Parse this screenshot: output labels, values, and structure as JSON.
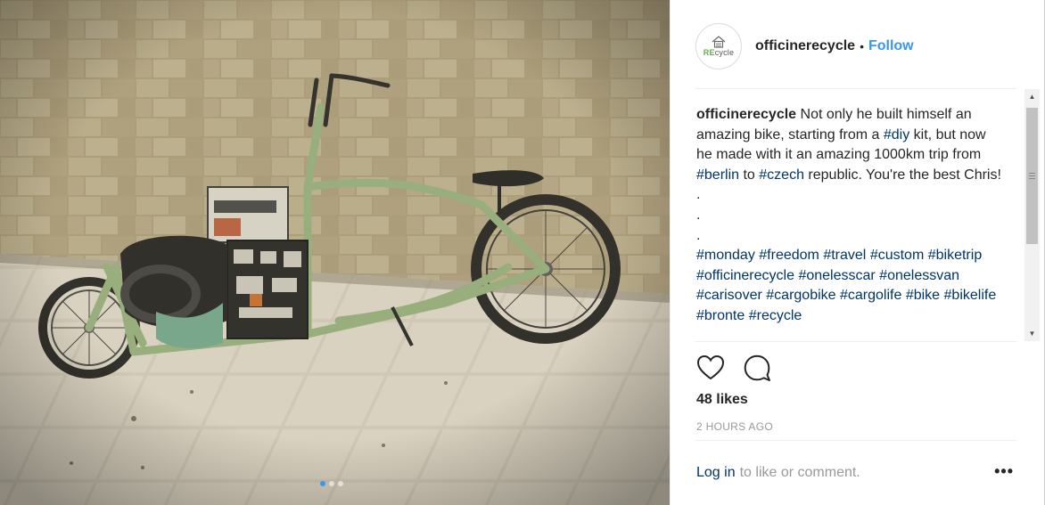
{
  "post": {
    "username": "officinerecycle",
    "separator": "•",
    "follow_label": "Follow",
    "avatar": {
      "logo_prefix": "RE",
      "logo_suffix": "cycle",
      "icon": "house-logo-icon"
    },
    "caption": {
      "username": "officinerecycle",
      "t1": " Not only he built himself an amazing bike, starting from a ",
      "tag1": "#diy",
      "t2": " kit, but now he made with it an amazing 1000km trip from ",
      "tag2": "#berlin",
      "t3": " to ",
      "tag3": "#czech",
      "t4": " republic. You're the best Chris!",
      "dots": [
        ".",
        ".",
        "."
      ],
      "hashtags": [
        "#monday",
        "#freedom",
        "#travel",
        "#custom",
        "#biketrip",
        "#officinerecycle",
        "#onelesscar",
        "#onelessvan",
        "#carisover",
        "#cargobike",
        "#cargolife",
        "#bike",
        "#bikelife",
        "#bronte",
        "#recycle"
      ]
    },
    "likes": "48 likes",
    "time": "2 HOURS AGO",
    "login_link": "Log in",
    "login_rest": "to like or comment.",
    "more_label": "•••",
    "icons": {
      "like": "heart-icon",
      "comment": "comment-bubble-icon"
    },
    "carousel": {
      "count": 3,
      "active": 0
    }
  },
  "colors": {
    "link": "#3897f0",
    "hashtag": "#003569",
    "muted": "#999999"
  }
}
